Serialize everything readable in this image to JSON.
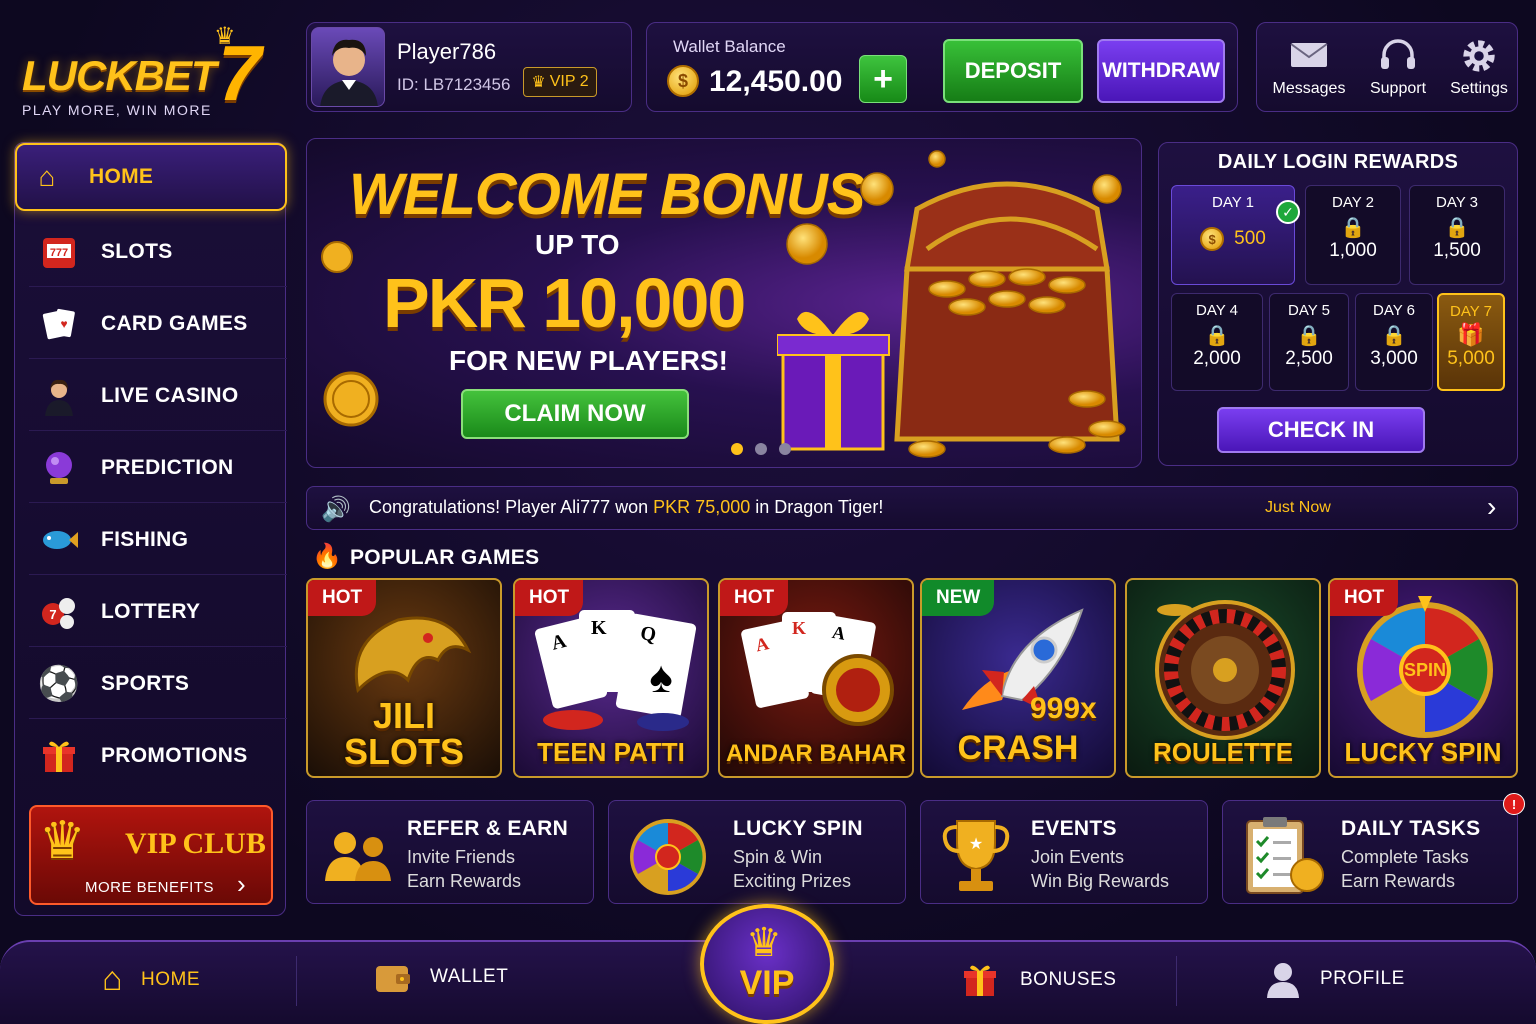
{
  "logo": {
    "brand": "LUCKBET",
    "number": "7",
    "tagline": "PLAY MORE, WIN MORE"
  },
  "player": {
    "name": "Player786",
    "id": "ID: LB7123456",
    "vip": "VIP 2"
  },
  "wallet": {
    "label": "Wallet Balance",
    "balance": "12,450.00",
    "add": "+",
    "deposit": "DEPOSIT",
    "withdraw": "WITHDRAW"
  },
  "top_icons": [
    {
      "label": "Messages",
      "icon": "envelope-icon"
    },
    {
      "label": "Support",
      "icon": "headset-icon"
    },
    {
      "label": "Settings",
      "icon": "gear-icon"
    }
  ],
  "sidebar": {
    "items": [
      {
        "label": "HOME",
        "icon": "home-icon"
      },
      {
        "label": "SLOTS",
        "icon": "slot-machine-icon"
      },
      {
        "label": "CARD GAMES",
        "icon": "cards-icon"
      },
      {
        "label": "LIVE CASINO",
        "icon": "dealer-icon"
      },
      {
        "label": "PREDICTION",
        "icon": "crystal-ball-icon"
      },
      {
        "label": "FISHING",
        "icon": "fish-icon"
      },
      {
        "label": "LOTTERY",
        "icon": "lottery-balls-icon"
      },
      {
        "label": "SPORTS",
        "icon": "soccer-ball-icon"
      },
      {
        "label": "PROMOTIONS",
        "icon": "gift-icon"
      }
    ],
    "vip_title": "VIP CLUB",
    "vip_sub": "MORE BENEFITS"
  },
  "banner": {
    "title": "WELCOME BONUS",
    "up_to": "UP TO",
    "amount": "PKR 10,000",
    "sub": "FOR NEW PLAYERS!",
    "cta": "CLAIM NOW",
    "slides": 3,
    "active_slide": 1
  },
  "daily": {
    "title": "DAILY LOGIN REWARDS",
    "days": [
      {
        "day": "DAY 1",
        "value": "500"
      },
      {
        "day": "DAY 2",
        "value": "1,000"
      },
      {
        "day": "DAY 3",
        "value": "1,500"
      },
      {
        "day": "DAY 4",
        "value": "2,000"
      },
      {
        "day": "DAY 5",
        "value": "2,500"
      },
      {
        "day": "DAY 6",
        "value": "3,000"
      },
      {
        "day": "DAY 7",
        "value": "5,000"
      }
    ],
    "check_in": "CHECK IN"
  },
  "ticker": {
    "prefix": "Congratulations! Player Ali777 won ",
    "amount": "PKR 75,000",
    "suffix": " in Dragon Tiger!",
    "time": "Just Now"
  },
  "popular": {
    "title": "POPULAR GAMES",
    "games": [
      {
        "tag": "HOT",
        "line1": "JILI",
        "line2": "SLOTS"
      },
      {
        "tag": "HOT",
        "line1": "",
        "line2": "TEEN PATTI"
      },
      {
        "tag": "HOT",
        "line1": "",
        "line2": "ANDAR BAHAR"
      },
      {
        "tag": "NEW",
        "line1": "999x",
        "line2": "CRASH"
      },
      {
        "tag": "",
        "line1": "",
        "line2": "ROULETTE"
      },
      {
        "tag": "HOT",
        "line1": "SPIN",
        "line2": "LUCKY SPIN"
      }
    ]
  },
  "features": [
    {
      "title": "REFER & EARN",
      "l1": "Invite Friends",
      "l2": "Earn Rewards"
    },
    {
      "title": "LUCKY SPIN",
      "l1": "Spin & Win",
      "l2": "Exciting Prizes"
    },
    {
      "title": "EVENTS",
      "l1": "Join Events",
      "l2": "Win Big Rewards"
    },
    {
      "title": "DAILY TASKS",
      "l1": "Complete Tasks",
      "l2": "Earn Rewards",
      "badge": "!"
    }
  ],
  "bottom_nav": {
    "home": "HOME",
    "wallet": "WALLET",
    "vip": "VIP",
    "bonuses": "BONUSES",
    "profile": "PROFILE"
  },
  "colors": {
    "gold": "#ffc21a",
    "purple": "#5b22c9",
    "green": "#1e9a1e",
    "bg": "#0d0820"
  }
}
